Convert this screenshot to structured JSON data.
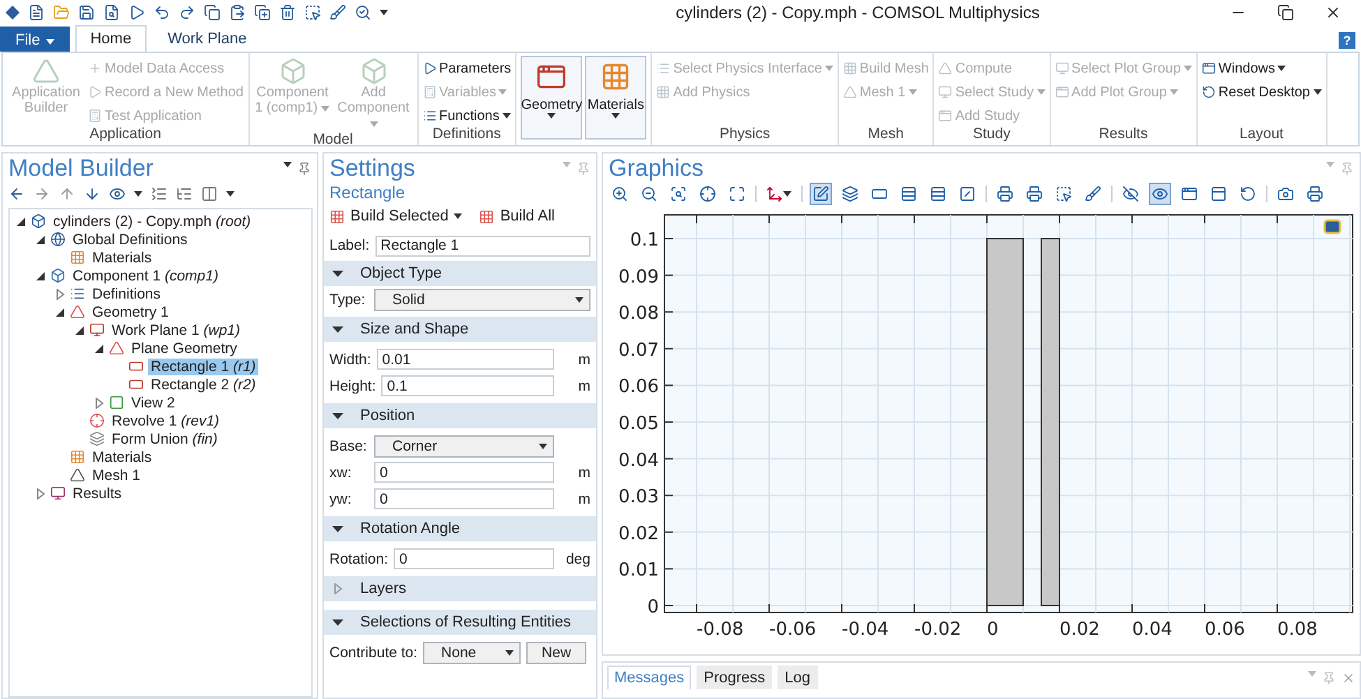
{
  "title_bar": {
    "title": "cylinders (2) - Copy.mph - COMSOL Multiphysics"
  },
  "ribbon_tabs": [
    {
      "label": "File",
      "kind": "file",
      "selected": false
    },
    {
      "label": "Home",
      "kind": "tab",
      "selected": true
    },
    {
      "label": "Work Plane",
      "kind": "tab",
      "selected": false
    }
  ],
  "help": "?",
  "ribbon_groups": [
    {
      "label": "Application",
      "items": [
        {
          "kind": "large",
          "label": "Application Builder",
          "disabled": true,
          "dropdown": false
        },
        {
          "kind": "small",
          "label": "Model Data Access",
          "disabled": true,
          "dropdown": false
        },
        {
          "kind": "small",
          "label": "Record a New Method",
          "disabled": true,
          "dropdown": false
        },
        {
          "kind": "small",
          "label": "Test Application",
          "disabled": true,
          "dropdown": false
        }
      ]
    },
    {
      "label": "Model",
      "items": [
        {
          "kind": "large",
          "label": "Component 1 (comp1)",
          "disabled": true,
          "dropdown": true
        },
        {
          "kind": "large",
          "label": "Add Component",
          "disabled": true,
          "dropdown": true
        }
      ]
    },
    {
      "label": "Definitions",
      "items": [
        {
          "kind": "small",
          "label": "Parameters",
          "disabled": false,
          "dropdown": false
        },
        {
          "kind": "small",
          "label": "Variables",
          "disabled": true,
          "dropdown": true
        },
        {
          "kind": "small",
          "label": "Functions",
          "disabled": false,
          "dropdown": true
        }
      ]
    },
    {
      "items": [
        {
          "kind": "framed",
          "label": "Geometry",
          "disabled": false,
          "dropdown": true
        },
        {
          "kind": "framed",
          "label": "Materials",
          "disabled": false,
          "dropdown": true
        }
      ]
    },
    {
      "label": "Physics",
      "items": [
        {
          "kind": "small",
          "label": "Select Physics Interface",
          "disabled": true,
          "dropdown": true
        },
        {
          "kind": "small",
          "label": "Add Physics",
          "disabled": true,
          "dropdown": false
        }
      ]
    },
    {
      "label": "Mesh",
      "items": [
        {
          "kind": "small",
          "label": "Build Mesh",
          "disabled": true,
          "dropdown": false
        },
        {
          "kind": "small",
          "label": "Mesh 1",
          "disabled": true,
          "dropdown": true
        }
      ]
    },
    {
      "label": "Study",
      "items": [
        {
          "kind": "small",
          "label": "Compute",
          "disabled": true,
          "dropdown": false
        },
        {
          "kind": "small",
          "label": "Select Study",
          "disabled": true,
          "dropdown": true
        },
        {
          "kind": "small",
          "label": "Add Study",
          "disabled": true,
          "dropdown": false
        }
      ]
    },
    {
      "label": "Results",
      "items": [
        {
          "kind": "small",
          "label": "Select Plot Group",
          "disabled": true,
          "dropdown": true
        },
        {
          "kind": "small",
          "label": "Add Plot Group",
          "disabled": true,
          "dropdown": true
        }
      ]
    },
    {
      "label": "Layout",
      "items": [
        {
          "kind": "small",
          "label": "Windows",
          "disabled": false,
          "dropdown": true
        },
        {
          "kind": "small",
          "label": "Reset Desktop",
          "disabled": false,
          "dropdown": true
        }
      ]
    }
  ],
  "model_builder": {
    "title": "Model Builder",
    "tree": [
      {
        "label": "cylinders (2) - Copy.mph",
        "tag": "(root)",
        "expanded": true,
        "selected": false,
        "children": [
          {
            "label": "Global Definitions",
            "expanded": true,
            "selected": false,
            "children": [
              {
                "label": "Materials",
                "selected": false
              }
            ]
          },
          {
            "label": "Component 1",
            "tag": "(comp1)",
            "expanded": true,
            "selected": false,
            "children": [
              {
                "label": "Definitions",
                "expanded": false,
                "selected": false
              },
              {
                "label": "Geometry 1",
                "expanded": true,
                "selected": false,
                "children": [
                  {
                    "label": "Work Plane 1",
                    "tag": "(wp1)",
                    "expanded": true,
                    "selected": false,
                    "children": [
                      {
                        "label": "Plane Geometry",
                        "expanded": true,
                        "selected": false,
                        "children": [
                          {
                            "label": "Rectangle 1",
                            "tag": "(r1)",
                            "selected": true
                          },
                          {
                            "label": "Rectangle 2",
                            "tag": "(r2)",
                            "selected": false
                          }
                        ]
                      },
                      {
                        "label": "View 2",
                        "expanded": false,
                        "selected": false
                      }
                    ]
                  },
                  {
                    "label": "Revolve 1",
                    "tag": "(rev1)",
                    "selected": false
                  },
                  {
                    "label": "Form Union",
                    "tag": "(fin)",
                    "selected": false
                  }
                ]
              },
              {
                "label": "Materials",
                "selected": false
              },
              {
                "label": "Mesh 1",
                "selected": false
              }
            ]
          },
          {
            "label": "Results",
            "expanded": false,
            "selected": false
          }
        ]
      }
    ]
  },
  "settings": {
    "title": "Settings",
    "subtitle": "Rectangle",
    "buttons": [
      {
        "label": "Build Selected",
        "dropdown": true
      },
      {
        "label": "Build All",
        "dropdown": false
      }
    ],
    "label_field": {
      "label": "Label:",
      "value": "Rectangle 1"
    },
    "sections": [
      {
        "title": "Object Type",
        "expanded": true,
        "fields": [
          {
            "kind": "select",
            "label": "Type:",
            "value": "Solid"
          }
        ]
      },
      {
        "title": "Size and Shape",
        "expanded": true,
        "fields": [
          {
            "kind": "text",
            "label": "Width:",
            "value": "0.01",
            "unit": "m"
          },
          {
            "kind": "text",
            "label": "Height:",
            "value": "0.1",
            "unit": "m"
          }
        ]
      },
      {
        "title": "Position",
        "expanded": true,
        "fields": [
          {
            "kind": "select",
            "label": "Base:",
            "value": "Corner"
          },
          {
            "kind": "text",
            "label": "xw:",
            "value": "0",
            "unit": "m"
          },
          {
            "kind": "text",
            "label": "yw:",
            "value": "0",
            "unit": "m"
          }
        ]
      },
      {
        "title": "Rotation Angle",
        "expanded": true,
        "fields": [
          {
            "kind": "text",
            "label": "Rotation:",
            "value": "0",
            "unit": "deg"
          }
        ]
      },
      {
        "title": "Layers",
        "expanded": false
      },
      {
        "title": "Selections of Resulting Entities",
        "expanded": true,
        "fields": [
          {
            "kind": "select",
            "label": "Contribute to:",
            "value": "None",
            "button": "New"
          }
        ]
      }
    ]
  },
  "graphics": {
    "title": "Graphics",
    "toolbar": [
      [
        {
          "pressed": false
        },
        {
          "pressed": false
        },
        {
          "pressed": false
        },
        {
          "pressed": false
        },
        {
          "pressed": false
        }
      ],
      [
        {
          "pressed": false
        }
      ],
      [
        {
          "pressed": true
        },
        {
          "pressed": false
        },
        {
          "pressed": false
        },
        {
          "pressed": false
        },
        {
          "pressed": false
        },
        {
          "pressed": false
        }
      ],
      [
        {
          "pressed": false
        },
        {
          "pressed": false
        },
        {
          "pressed": false
        },
        {
          "pressed": false
        }
      ],
      [
        {
          "pressed": false
        },
        {
          "pressed": true
        },
        {
          "pressed": false
        },
        {
          "pressed": false
        },
        {
          "pressed": false
        }
      ],
      [
        {
          "pressed": false
        },
        {
          "pressed": false
        }
      ]
    ],
    "y_tick_labels": [
      "0.1",
      "0.09",
      "0.08",
      "0.07",
      "0.06",
      "0.05",
      "0.04",
      "0.03",
      "0.02",
      "0.01",
      "0"
    ],
    "x_tick_labels": [
      "-0.08",
      "-0.06",
      "-0.04",
      "-0.02",
      "0",
      "0.02",
      "0.04",
      "0.06",
      "0.08"
    ]
  },
  "messages_tabs": [
    {
      "label": "Messages",
      "selected": true
    },
    {
      "label": "Progress",
      "selected": false
    },
    {
      "label": "Log",
      "selected": false
    }
  ]
}
